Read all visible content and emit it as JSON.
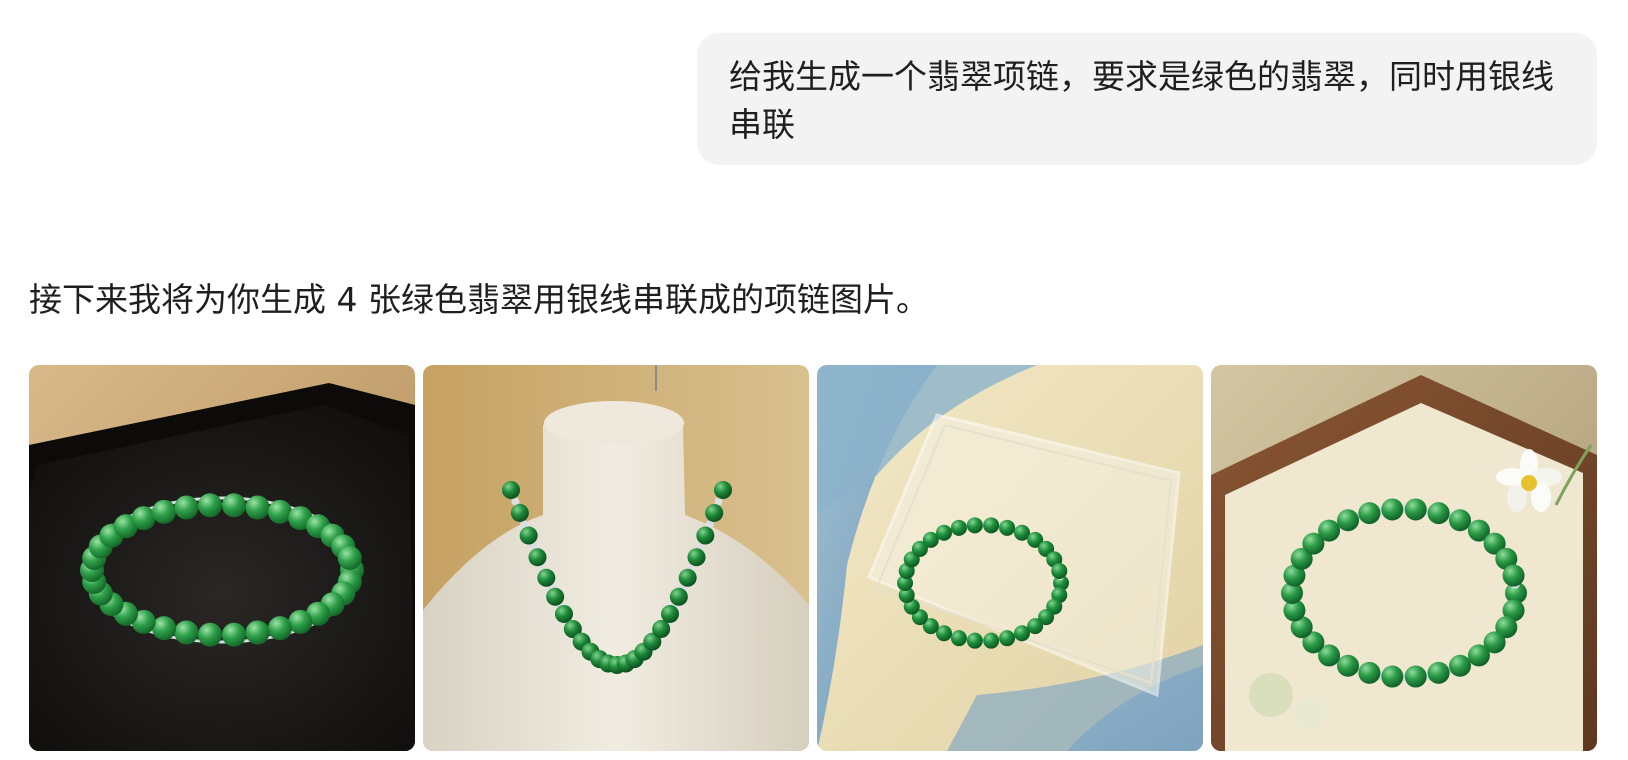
{
  "conversation": {
    "user_message": "给我生成一个翡翠项链，要求是绿色的翡翠，同时用银线串联",
    "assistant_message": "接下来我将为你生成 4 张绿色翡翠用银线串联成的项链图片。"
  },
  "generated_images": [
    {
      "subject": "jade bracelet on black velvet tray",
      "jade_color": "#2f9e46",
      "background_color": "#1a1816"
    },
    {
      "subject": "jade necklace on white bust",
      "jade_color": "#1f8a3a",
      "background_color": "#c9a86a"
    },
    {
      "subject": "jade bracelet on clear acrylic block",
      "jade_color": "#1e8f3c",
      "background_color": "#e8dcb4"
    },
    {
      "subject": "jade bracelet on wooden tray with flower",
      "jade_color": "#2a9a45",
      "background_color": "#7a4a2a"
    }
  ]
}
